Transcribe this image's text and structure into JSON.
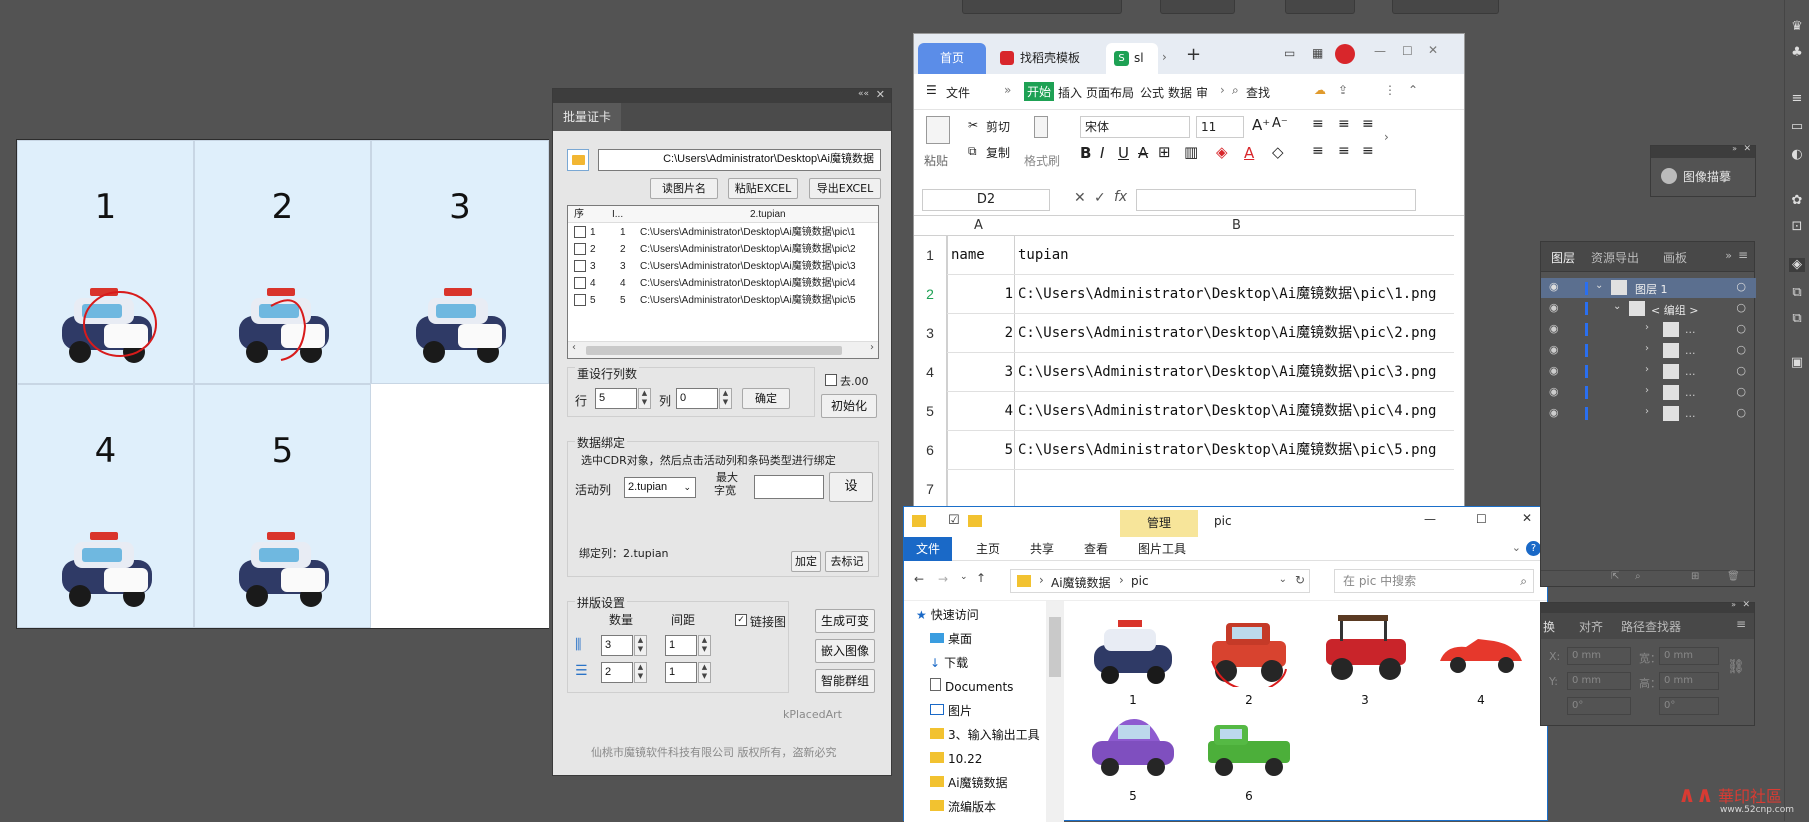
{
  "artboard": {
    "cells": [
      "1",
      "2",
      "3",
      "4",
      "5"
    ]
  },
  "plugin": {
    "tab": "批量证卡",
    "path_value": "C:\\Users\\Administrator\\Desktop\\Ai魔镜数据",
    "read_btn": "读图片名",
    "paste_btn": "粘贴EXCEL",
    "export_btn": "导出EXCEL",
    "list_headers": [
      "序",
      "I...",
      "2.tupian"
    ],
    "list_rows": [
      {
        "seq": "1",
        "idx": "1",
        "path": "C:\\Users\\Administrator\\Desktop\\Ai魔镜数据\\pic\\1"
      },
      {
        "seq": "2",
        "idx": "2",
        "path": "C:\\Users\\Administrator\\Desktop\\Ai魔镜数据\\pic\\2"
      },
      {
        "seq": "3",
        "idx": "3",
        "path": "C:\\Users\\Administrator\\Desktop\\Ai魔镜数据\\pic\\3"
      },
      {
        "seq": "4",
        "idx": "4",
        "path": "C:\\Users\\Administrator\\Desktop\\Ai魔镜数据\\pic\\4"
      },
      {
        "seq": "5",
        "idx": "5",
        "path": "C:\\Users\\Administrator\\Desktop\\Ai魔镜数据\\pic\\5"
      }
    ],
    "reset_group": "重设行列数",
    "row_label": "行",
    "row_value": "5",
    "col_label": "列",
    "col_value": "0",
    "confirm_btn": "确定",
    "trim_label": "去.00",
    "init_btn": "初始化",
    "bind_group": "数据绑定",
    "bind_hint": "选中CDR对象，然后点击活动列和条码类型进行绑定",
    "active_col_label": "活动列",
    "active_col_value": "2.tupian",
    "max_width_label_1": "最大",
    "max_width_label_2": "字宽",
    "set_btn": "设",
    "bound_col": "绑定列：2.tupian",
    "add_mark_btn": "加定",
    "remove_mark_btn": "去标记",
    "layout_group": "拼版设置",
    "qty_label": "数量",
    "gap_label": "间距",
    "qty_x": "3",
    "gap_x": "1",
    "qty_y": "2",
    "gap_y": "1",
    "link_label": "链接图",
    "gen_btn": "生成可变",
    "embed_btn": "嵌入图像",
    "group_btn": "智能群组",
    "kplaced": "kPlacedArt",
    "copyright": "仙桃市魔镜软件科技有限公司  版权所有，盗新必究"
  },
  "wps": {
    "tab_home": "首页",
    "tab_template": "找稻壳模板",
    "tab_sheet": "sl",
    "menu_file": "文件",
    "menu_items": [
      "开始",
      "插入",
      "页面布局",
      "公式",
      "数据",
      "审"
    ],
    "search": "查找",
    "paste": "粘贴",
    "cut": "剪切",
    "copy": "复制",
    "format_brush": "格式刷",
    "font": "宋体",
    "font_size": "11",
    "cell_ref": "D2",
    "col_headers": [
      "A",
      "B"
    ],
    "rows": [
      {
        "n": "1",
        "a": "name",
        "b": "tupian"
      },
      {
        "n": "2",
        "a": "1",
        "b": "C:\\Users\\Administrator\\Desktop\\Ai魔镜数据\\pic\\1.png"
      },
      {
        "n": "3",
        "a": "2",
        "b": "C:\\Users\\Administrator\\Desktop\\Ai魔镜数据\\pic\\2.png"
      },
      {
        "n": "4",
        "a": "3",
        "b": "C:\\Users\\Administrator\\Desktop\\Ai魔镜数据\\pic\\3.png"
      },
      {
        "n": "5",
        "a": "4",
        "b": "C:\\Users\\Administrator\\Desktop\\Ai魔镜数据\\pic\\4.png"
      },
      {
        "n": "6",
        "a": "5",
        "b": "C:\\Users\\Administrator\\Desktop\\Ai魔镜数据\\pic\\5.png"
      },
      {
        "n": "7",
        "a": "",
        "b": ""
      }
    ]
  },
  "explorer": {
    "manage": "管理",
    "title": "pic",
    "tabs": [
      "文件",
      "主页",
      "共享",
      "查看",
      "图片工具"
    ],
    "path_1": "Ai魔镜数据",
    "path_2": "pic",
    "search_placeholder": "在 pic 中搜索",
    "nav": [
      "快速访问",
      "桌面",
      "下载",
      "Documents",
      "图片",
      "3、输入输出工具",
      "10.22",
      "Ai魔镜数据",
      "流编版本"
    ],
    "files": [
      "1",
      "2",
      "3",
      "4",
      "5",
      "6"
    ]
  },
  "ai": {
    "trace_label": "图像描摹",
    "layer_tabs": [
      "图层",
      "资源导出",
      "画板"
    ],
    "layer_name": "图层 1",
    "group_name": "< 编组 >",
    "sublayer": "...",
    "transform_tabs": [
      "换",
      "对齐",
      "路径查找器"
    ],
    "x_label": "X:",
    "y_label": "Y:",
    "w_label": "宽：",
    "h_label": "高：",
    "zero_mm": "0 mm",
    "zero_deg": "0°"
  },
  "watermark": "華印社區",
  "watermark_url": "www.52cnp.com"
}
